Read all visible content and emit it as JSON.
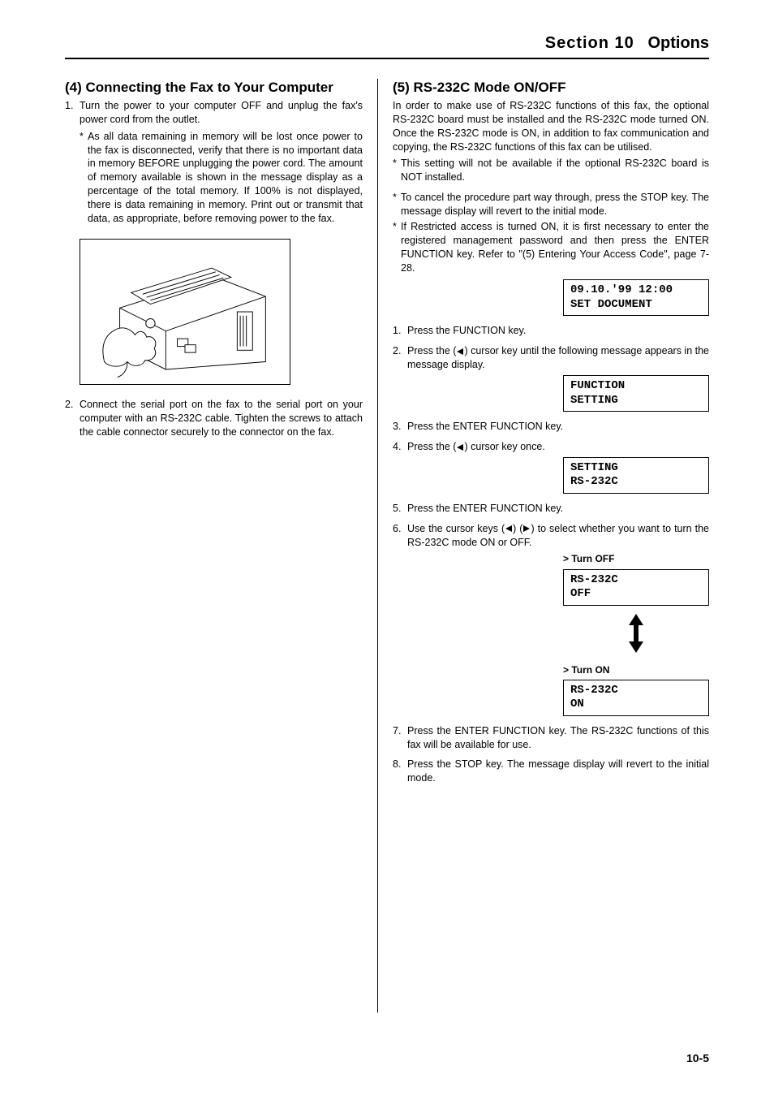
{
  "header": {
    "section_label": "Section 10",
    "section_title": "Options"
  },
  "left": {
    "heading": "(4) Connecting the Fax to Your Computer",
    "step1_num": "1.",
    "step1_text": "Turn the power to your computer OFF and unplug the fax's power cord from the outlet.",
    "note1_star": "*",
    "note1_text": "As all data remaining in memory will be lost once power to the fax is disconnected, verify that there is no important data in memory BEFORE unplugging the power cord. The amount of memory available is shown in the message display as a percentage of the total memory. If 100% is not displayed, there is data remaining in memory. Print out or transmit that data, as appropriate, before removing power to the fax.",
    "step2_num": "2.",
    "step2_text": "Connect the serial port on the fax to the serial port on your computer with an RS-232C cable. Tighten the screws to attach the cable connector securely to the connector on the fax."
  },
  "right": {
    "heading": "(5) RS-232C Mode ON/OFF",
    "intro": "In order to make use of RS-232C functions of this fax, the optional RS-232C board must be installed and the RS-232C mode turned ON. Once the RS-232C mode is ON, in addition to fax communication and copying, the RS-232C functions of this fax can be utilised.",
    "noteA_star": "*",
    "noteA_text": "This setting will not be available if the optional RS-232C board is NOT installed.",
    "noteB_star": "*",
    "noteB_text": "To cancel the procedure part way through, press the STOP key. The message display will revert to the initial mode.",
    "noteC_star": "*",
    "noteC_text": "If Restricted access is turned ON, it is first necessary to enter the registered management password and then press the ENTER FUNCTION key. Refer to \"(5) Entering Your Access Code\", page 7-28.",
    "lcd1_line1": "09.10.'99 12:00",
    "lcd1_line2": "SET DOCUMENT",
    "s1_num": "1.",
    "s1_text": "Press the FUNCTION key.",
    "s2_num": "2.",
    "s2_text_a": "Press the (",
    "s2_text_b": ") cursor key until the following message appears in the message display.",
    "lcd2_line1": "FUNCTION",
    "lcd2_line2": "SETTING",
    "s3_num": "3.",
    "s3_text": "Press the ENTER FUNCTION key.",
    "s4_num": "4.",
    "s4_text_a": "Press the (",
    "s4_text_b": ") cursor key once.",
    "lcd3_line1": "SETTING",
    "lcd3_line2": "RS-232C",
    "s5_num": "5.",
    "s5_text": "Press the ENTER FUNCTION key.",
    "s6_num": "6.",
    "s6_text_a": "Use the cursor keys (",
    "s6_text_b": ") (",
    "s6_text_c": ") to select whether you want to turn the RS-232C mode ON or OFF.",
    "turn_off_label": "> Turn OFF",
    "lcd4_line1": "RS-232C",
    "lcd4_line2": "OFF",
    "turn_on_label": "> Turn ON",
    "lcd5_line1": "RS-232C",
    "lcd5_line2": "ON",
    "s7_num": "7.",
    "s7_text": "Press the ENTER FUNCTION key. The RS-232C functions of this fax will be available for use.",
    "s8_num": "8.",
    "s8_text": "Press the STOP key. The message display will revert to the initial mode."
  },
  "footer": {
    "page": "10-5"
  }
}
